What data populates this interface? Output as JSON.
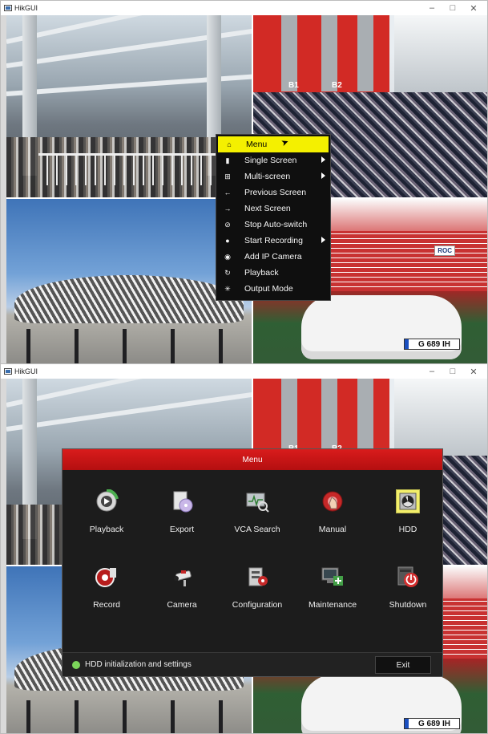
{
  "window1": {
    "title": "HikGUI",
    "controls": {
      "minimize": "–",
      "maximize": "□",
      "close": "✕"
    },
    "context_menu": {
      "items": [
        {
          "label": "Menu",
          "icon": "home-icon",
          "glyph": "⌂",
          "submenu": false,
          "active": true
        },
        {
          "label": "Single Screen",
          "icon": "single-screen-icon",
          "glyph": "▮",
          "submenu": true
        },
        {
          "label": "Multi-screen",
          "icon": "multi-screen-icon",
          "glyph": "⊞",
          "submenu": true
        },
        {
          "label": "Previous Screen",
          "icon": "arrow-left-icon",
          "glyph": "←",
          "submenu": false
        },
        {
          "label": "Next Screen",
          "icon": "arrow-right-icon",
          "glyph": "→",
          "submenu": false
        },
        {
          "label": "Stop Auto-switch",
          "icon": "stop-icon",
          "glyph": "⊘",
          "submenu": false
        },
        {
          "label": "Start Recording",
          "icon": "record-icon",
          "glyph": "●",
          "submenu": true
        },
        {
          "label": "Add IP Camera",
          "icon": "camera-icon",
          "glyph": "◉",
          "submenu": false
        },
        {
          "label": "Playback",
          "icon": "playback-icon",
          "glyph": "↻",
          "submenu": false
        },
        {
          "label": "Output Mode",
          "icon": "output-mode-icon",
          "glyph": "✳",
          "submenu": false
        }
      ]
    }
  },
  "window2": {
    "title": "HikGUI",
    "controls": {
      "minimize": "–",
      "maximize": "□",
      "close": "✕"
    },
    "dialog": {
      "title": "Menu",
      "tiles": [
        {
          "label": "Playback",
          "icon": "playback-icon"
        },
        {
          "label": "Export",
          "icon": "export-icon"
        },
        {
          "label": "VCA Search",
          "icon": "vca-search-icon"
        },
        {
          "label": "Manual",
          "icon": "manual-icon"
        },
        {
          "label": "HDD",
          "icon": "hdd-icon",
          "selected": true
        },
        {
          "label": "Record",
          "icon": "record-icon"
        },
        {
          "label": "Camera",
          "icon": "camera-icon"
        },
        {
          "label": "Configuration",
          "icon": "configuration-icon"
        },
        {
          "label": "Maintenance",
          "icon": "maintenance-icon"
        },
        {
          "label": "Shutdown",
          "icon": "shutdown-icon"
        }
      ],
      "status_text": "HDD initialization and settings",
      "exit_label": "Exit"
    }
  },
  "feeds": {
    "gate_labels": [
      "B1",
      "B2"
    ],
    "plate": "G 689 IH",
    "sign": "ROC"
  },
  "colors": {
    "accent_red": "#c8151a",
    "highlight_yellow": "#f4f000",
    "status_green": "#7bd55a"
  }
}
